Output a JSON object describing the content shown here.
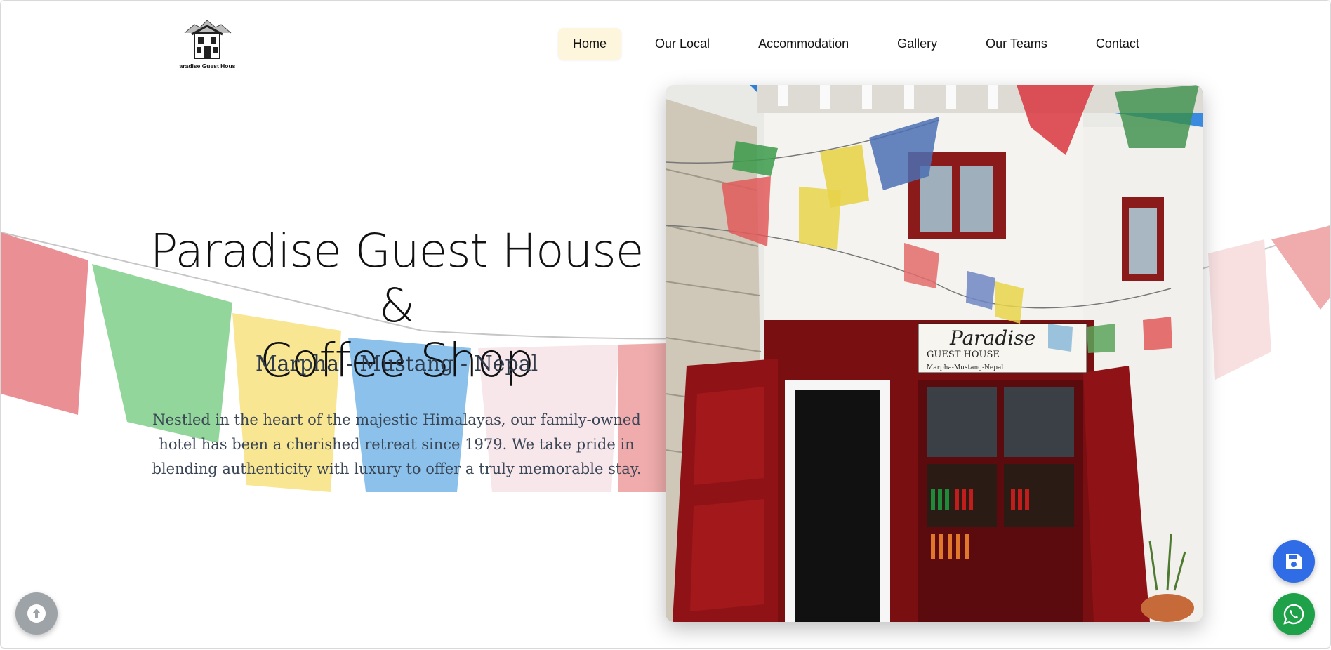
{
  "logo": {
    "caption": "Paradise Guest House"
  },
  "nav": {
    "items": [
      {
        "label": "Home",
        "active": true
      },
      {
        "label": "Our Local",
        "active": false
      },
      {
        "label": "Accommodation",
        "active": false
      },
      {
        "label": "Gallery",
        "active": false
      },
      {
        "label": "Our Teams",
        "active": false
      },
      {
        "label": "Contact",
        "active": false
      }
    ]
  },
  "hero": {
    "title_line1": "Paradise Guest House &",
    "title_line2": "Coffee Shop",
    "subtitle": "Marpha - Mustang - Nepal",
    "description": "Nestled in the heart of the majestic Himalayas, our family-owned hotel has been a cherished retreat since 1979. We take pride in blending authenticity with luxury to offer a truly memorable stay."
  },
  "photo": {
    "sign_line1": "Paradise",
    "sign_line2": "GUEST HOUSE",
    "sign_line3": "Marpha-Mustang-Nepal"
  },
  "icons": {
    "scroll_up": "arrow-up-icon",
    "save": "floppy-disk-icon",
    "whatsapp": "whatsapp-icon"
  },
  "colors": {
    "nav_active_bg": "#fdf6dc",
    "save_button": "#2f6ce5",
    "whatsapp_button": "#1fa14a",
    "scroll_button": "#9ea3a8"
  }
}
